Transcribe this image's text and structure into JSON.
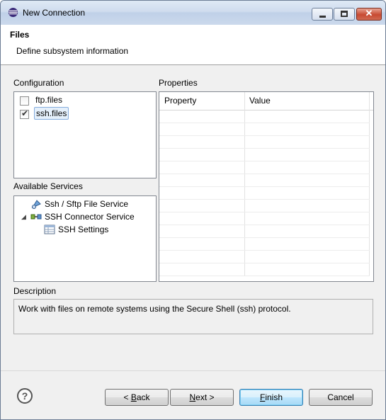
{
  "window": {
    "title": "New Connection",
    "controls": {
      "minimize": "minimize-icon",
      "maximize": "maximize-icon",
      "close": "close-icon"
    }
  },
  "header": {
    "title": "Files",
    "description": "Define subsystem information"
  },
  "configuration": {
    "label": "Configuration",
    "items": [
      {
        "label": "ftp.files",
        "checked": false
      },
      {
        "label": "ssh.files",
        "checked": true
      }
    ]
  },
  "services": {
    "label": "Available Services",
    "items": [
      {
        "label": "Ssh / Sftp File Service",
        "icon": "file-service-icon"
      },
      {
        "label": "SSH Connector Service",
        "icon": "connector-service-icon",
        "expanded": true
      },
      {
        "label": "SSH Settings",
        "icon": "settings-table-icon"
      }
    ]
  },
  "properties": {
    "label": "Properties",
    "columns": [
      "Property",
      "Value"
    ]
  },
  "description": {
    "label": "Description",
    "text": "Work with files on remote systems using the Secure Shell (ssh) protocol."
  },
  "buttons": {
    "back": {
      "mnemonic": "B",
      "rest": "ack",
      "prefix": "< "
    },
    "next": {
      "mnemonic": "N",
      "rest": "ext",
      "suffix": " >"
    },
    "finish": {
      "mnemonic": "F",
      "rest": "inish"
    },
    "cancel": "Cancel"
  },
  "help_icon": "help-icon"
}
